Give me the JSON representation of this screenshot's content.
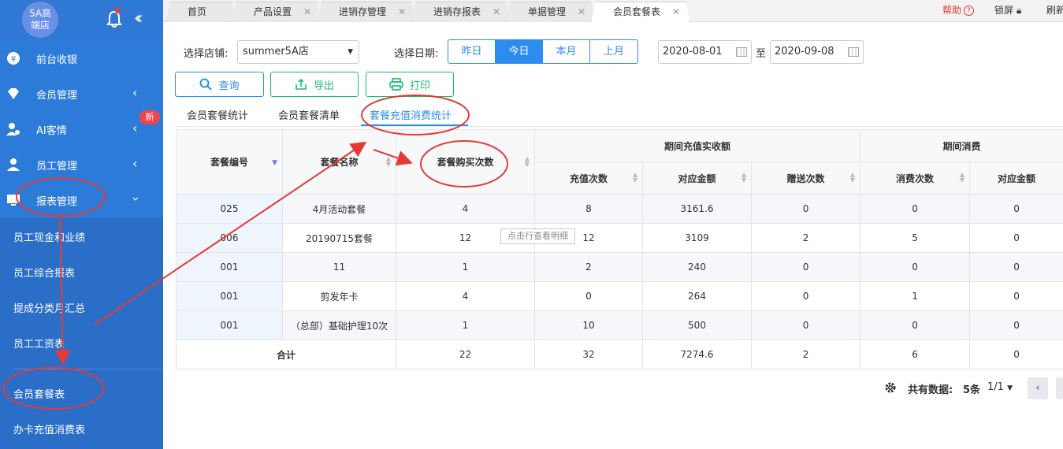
{
  "sidebar": {
    "logo": "5A高端店",
    "menu": [
      {
        "label": "前台收银"
      },
      {
        "label": "会员管理"
      },
      {
        "label": "AI客情"
      },
      {
        "label": "员工管理"
      },
      {
        "label": "报表管理"
      }
    ],
    "badge": "新",
    "submenu": [
      "员工现金和业绩",
      "员工综合报表",
      "提成分类月汇总",
      "员工工资表",
      "会员套餐表",
      "办卡充值消费表"
    ]
  },
  "tabs": [
    "首页",
    "产品设置",
    "进销存管理",
    "进销存报表",
    "单据管理",
    "会员套餐表"
  ],
  "topright": {
    "help": "帮助",
    "lock": "锁屏",
    "refresh": "刷新"
  },
  "filters": {
    "store_label": "选择店铺:",
    "store_value": "summer5A店",
    "date_label": "选择日期:",
    "quick": [
      "昨日",
      "今日",
      "本月",
      "上月"
    ],
    "from": "2020-08-01",
    "to_sep": "至",
    "to": "2020-09-08"
  },
  "buttons": {
    "search": "查询",
    "export": "导出",
    "print": "打印"
  },
  "subtabs": [
    "会员套餐统计",
    "会员套餐清单",
    "套餐充值消费统计"
  ],
  "table": {
    "headers": {
      "code": "套餐编号",
      "name": "套餐名称",
      "buy": "套餐购买次数",
      "group1": "期间充值实收额",
      "group2": "期间消费",
      "recharge_count": "充值次数",
      "recharge_amount": "对应金额",
      "gift_count": "赠送次数",
      "consume_count": "消费次数",
      "consume_amount": "对应金额"
    },
    "rows": [
      [
        "025",
        "4月活动套餐",
        "4",
        "8",
        "3161.6",
        "0",
        "0",
        "0"
      ],
      [
        "006",
        "20190715套餐",
        "12",
        "12",
        "3109",
        "2",
        "5",
        "0"
      ],
      [
        "001",
        "11",
        "1",
        "2",
        "240",
        "0",
        "0",
        "0"
      ],
      [
        "001",
        "剪发年卡",
        "4",
        "0",
        "264",
        "0",
        "1",
        "0"
      ],
      [
        "001",
        "（总部）基础护理10次",
        "1",
        "10",
        "500",
        "0",
        "0",
        "0"
      ]
    ],
    "total": [
      "合计",
      "22",
      "32",
      "7274.6",
      "2",
      "6",
      "0"
    ],
    "tooltip": "点击行查看明细"
  },
  "pager": {
    "total_label": "共有数据:",
    "total_value": "5条",
    "page": "1/1"
  },
  "colors": {
    "sidebar": "#2d7bd8",
    "primary": "#2d8cf0",
    "green": "#19be6b",
    "annotation": "#e53935"
  }
}
